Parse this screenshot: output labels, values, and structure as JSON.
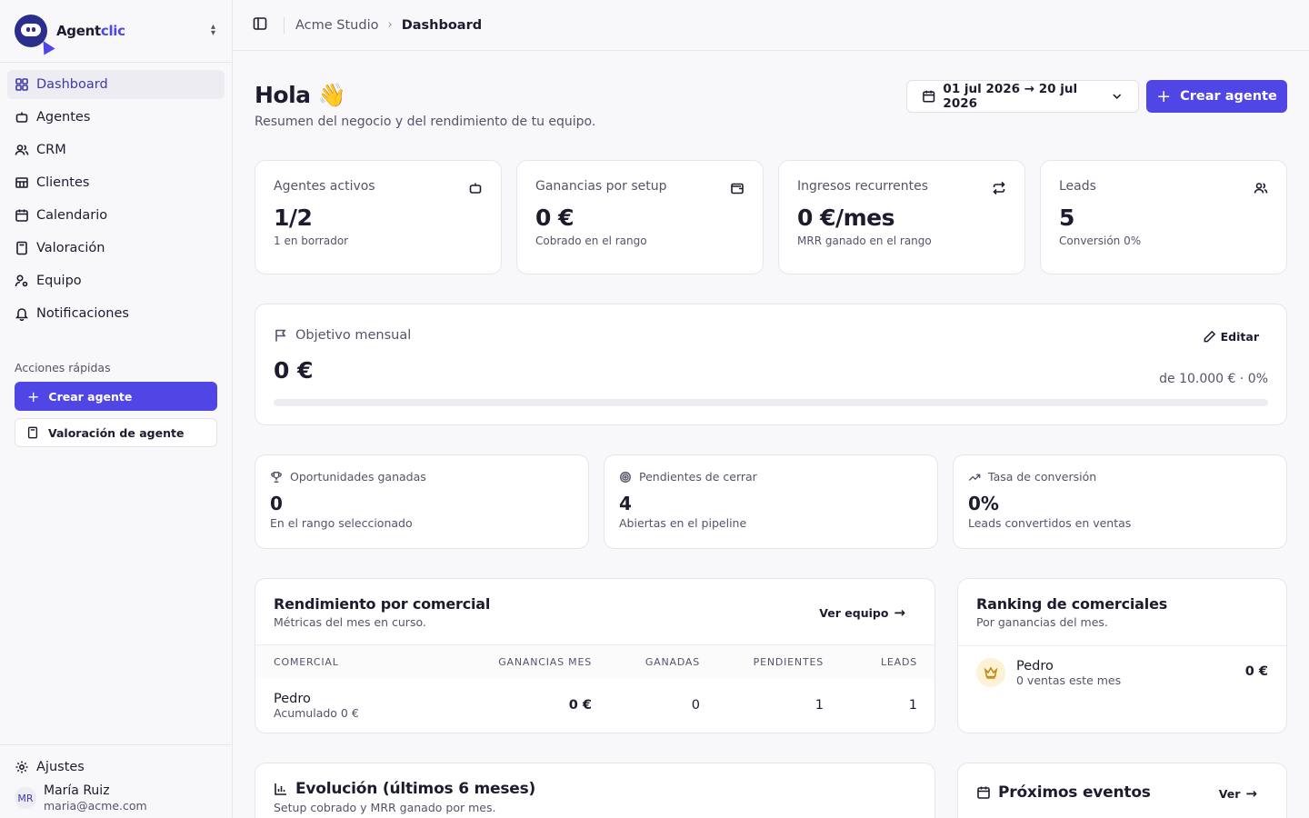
{
  "brand": {
    "name_plain": "Agent",
    "name_accent": "clic"
  },
  "nav": [
    {
      "label": "Dashboard",
      "icon": "layout-grid-icon",
      "active": true
    },
    {
      "label": "Agentes",
      "icon": "bot-icon"
    },
    {
      "label": "CRM",
      "icon": "users-icon"
    },
    {
      "label": "Clientes",
      "icon": "building-icon"
    },
    {
      "label": "Calendario",
      "icon": "calendar-icon"
    },
    {
      "label": "Valoración",
      "icon": "calculator-icon"
    },
    {
      "label": "Equipo",
      "icon": "user-cog-icon"
    },
    {
      "label": "Notificaciones",
      "icon": "bell-icon"
    }
  ],
  "quick_actions": {
    "title": "Acciones rápidas",
    "primary": "Crear agente",
    "secondary": "Valoración de agente"
  },
  "footer": {
    "settings": "Ajustes",
    "user": {
      "initials": "MR",
      "name": "María Ruiz",
      "email": "maria@acme.com"
    }
  },
  "breadcrumb": {
    "parent": "Acme Studio",
    "current": "Dashboard"
  },
  "header": {
    "title": "Hola 👋",
    "subtitle": "Resumen del negocio y del rendimiento de tu equipo.",
    "date_range": "01 jul 2026 → 20 jul 2026",
    "create_label": "Crear agente"
  },
  "kpis": [
    {
      "title": "Agentes activos",
      "value": "1/2",
      "sub": "1 en borrador",
      "icon": "bot-icon"
    },
    {
      "title": "Ganancias por setup",
      "value": "0 €",
      "sub": "Cobrado en el rango",
      "icon": "wallet-icon"
    },
    {
      "title": "Ingresos recurrentes",
      "value": "0 €/mes",
      "sub": "MRR ganado en el rango",
      "icon": "repeat-icon"
    },
    {
      "title": "Leads",
      "value": "5",
      "sub": "Conversión 0%",
      "icon": "users-icon"
    }
  ],
  "goal": {
    "title": "Objetivo mensual",
    "edit": "Editar",
    "value": "0 €",
    "of": "de 10.000 € · 0%",
    "progress_percent": 0
  },
  "mini": [
    {
      "title": "Oportunidades ganadas",
      "value": "0",
      "sub": "En el rango seleccionado",
      "icon": "trophy-icon"
    },
    {
      "title": "Pendientes de cerrar",
      "value": "4",
      "sub": "Abiertas en el pipeline",
      "icon": "target-icon"
    },
    {
      "title": "Tasa de conversión",
      "value": "0%",
      "sub": "Leads convertidos en ventas",
      "icon": "trending-up-icon"
    }
  ],
  "performance": {
    "title": "Rendimiento por comercial",
    "subtitle": "Métricas del mes en curso.",
    "link": "Ver equipo",
    "columns": [
      "Comercial",
      "Ganancias mes",
      "Ganadas",
      "Pendientes",
      "Leads"
    ],
    "rows": [
      {
        "name": "Pedro",
        "accumulated": "Acumulado 0 €",
        "earnings": "0 €",
        "won": "0",
        "pending": "1",
        "leads": "1"
      }
    ]
  },
  "ranking": {
    "title": "Ranking de comerciales",
    "subtitle": "Por ganancias del mes.",
    "rows": [
      {
        "name": "Pedro",
        "sub": "0 ventas este mes",
        "value": "0 €"
      }
    ]
  },
  "evolution": {
    "title": "Evolución (últimos 6 meses)",
    "subtitle": "Setup cobrado y MRR ganado por mes."
  },
  "events": {
    "title": "Próximos eventos",
    "link": "Ver"
  },
  "colors": {
    "accent": "#4f46e5",
    "brand_dark": "#2b2e8a",
    "crown": "#c08a10"
  }
}
